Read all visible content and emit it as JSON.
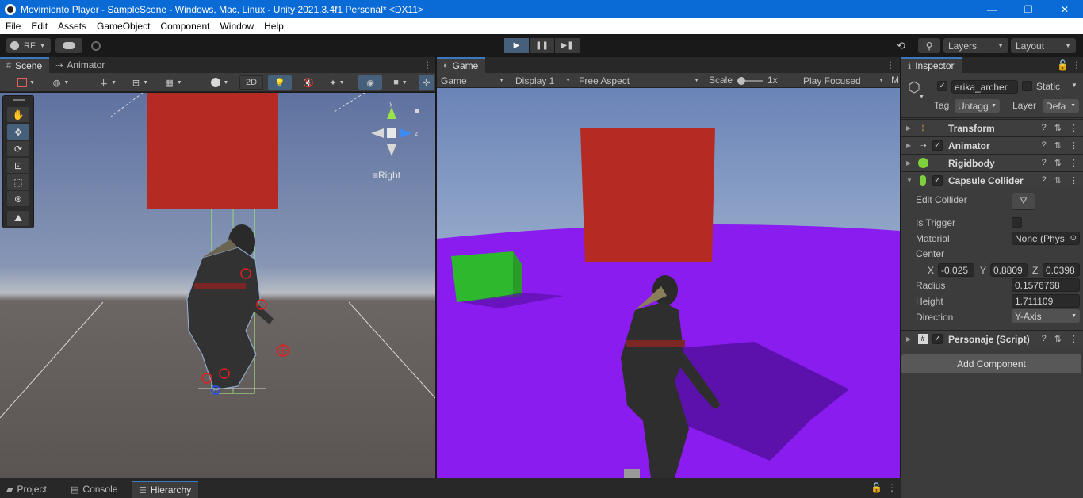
{
  "window": {
    "title": "Movimiento Player - SampleScene - Windows, Mac, Linux - Unity 2021.3.4f1 Personal* <DX11>",
    "minimize": "—",
    "maximize": "❐",
    "close": "✕"
  },
  "menu": [
    "File",
    "Edit",
    "Assets",
    "GameObject",
    "Component",
    "Window",
    "Help"
  ],
  "toolbar": {
    "account_label": "RF",
    "layers_label": "Layers",
    "layout_label": "Layout"
  },
  "scene_panel": {
    "tabs": [
      {
        "label": "Scene",
        "icon": "grid-icon"
      },
      {
        "label": "Animator",
        "icon": "animator-icon"
      }
    ],
    "mode_2d": "2D",
    "gizmo_label": "Right",
    "colors": {
      "red_quad": "#b52a22"
    }
  },
  "game_panel": {
    "tab_label": "Game",
    "display_mode": "Game",
    "display": "Display 1",
    "aspect": "Free Aspect",
    "scale_label": "Scale",
    "scale_value": "1x",
    "play_focused": "Play Focused",
    "more": "M",
    "colors": {
      "ground": "#8a1cf0",
      "cube_red": "#b52a22",
      "cube_green": "#2db82d"
    }
  },
  "inspector": {
    "tab_label": "Inspector",
    "object_name": "erika_archer",
    "static_label": "Static",
    "tag_label": "Tag",
    "tag_value": "Untagg",
    "layer_label": "Layer",
    "layer_value": "Defa",
    "components": [
      {
        "name": "Transform",
        "icon": "transform-icon"
      },
      {
        "name": "Animator",
        "icon": "animator-icon"
      },
      {
        "name": "Rigidbody",
        "icon": "rigidbody-icon"
      },
      {
        "name": "Capsule Collider",
        "icon": "capsule-collider-icon"
      },
      {
        "name": "Personaje (Script)",
        "icon": "script-icon"
      }
    ],
    "capsule": {
      "edit_collider": "Edit Collider",
      "is_trigger": "Is Trigger",
      "material_label": "Material",
      "material_value": "None (Phys",
      "center_label": "Center",
      "x_label": "X",
      "x_value": "-0.025",
      "y_label": "Y",
      "y_value": "0.8809",
      "z_label": "Z",
      "z_value": "0.0398",
      "radius_label": "Radius",
      "radius_value": "0.1576768",
      "height_label": "Height",
      "height_value": "1.711109",
      "direction_label": "Direction",
      "direction_value": "Y-Axis"
    },
    "add_component": "Add Component"
  },
  "bottom_tabs": [
    {
      "label": "Project",
      "icon": "folder-icon"
    },
    {
      "label": "Console",
      "icon": "console-icon"
    },
    {
      "label": "Hierarchy",
      "icon": "hierarchy-icon"
    }
  ]
}
